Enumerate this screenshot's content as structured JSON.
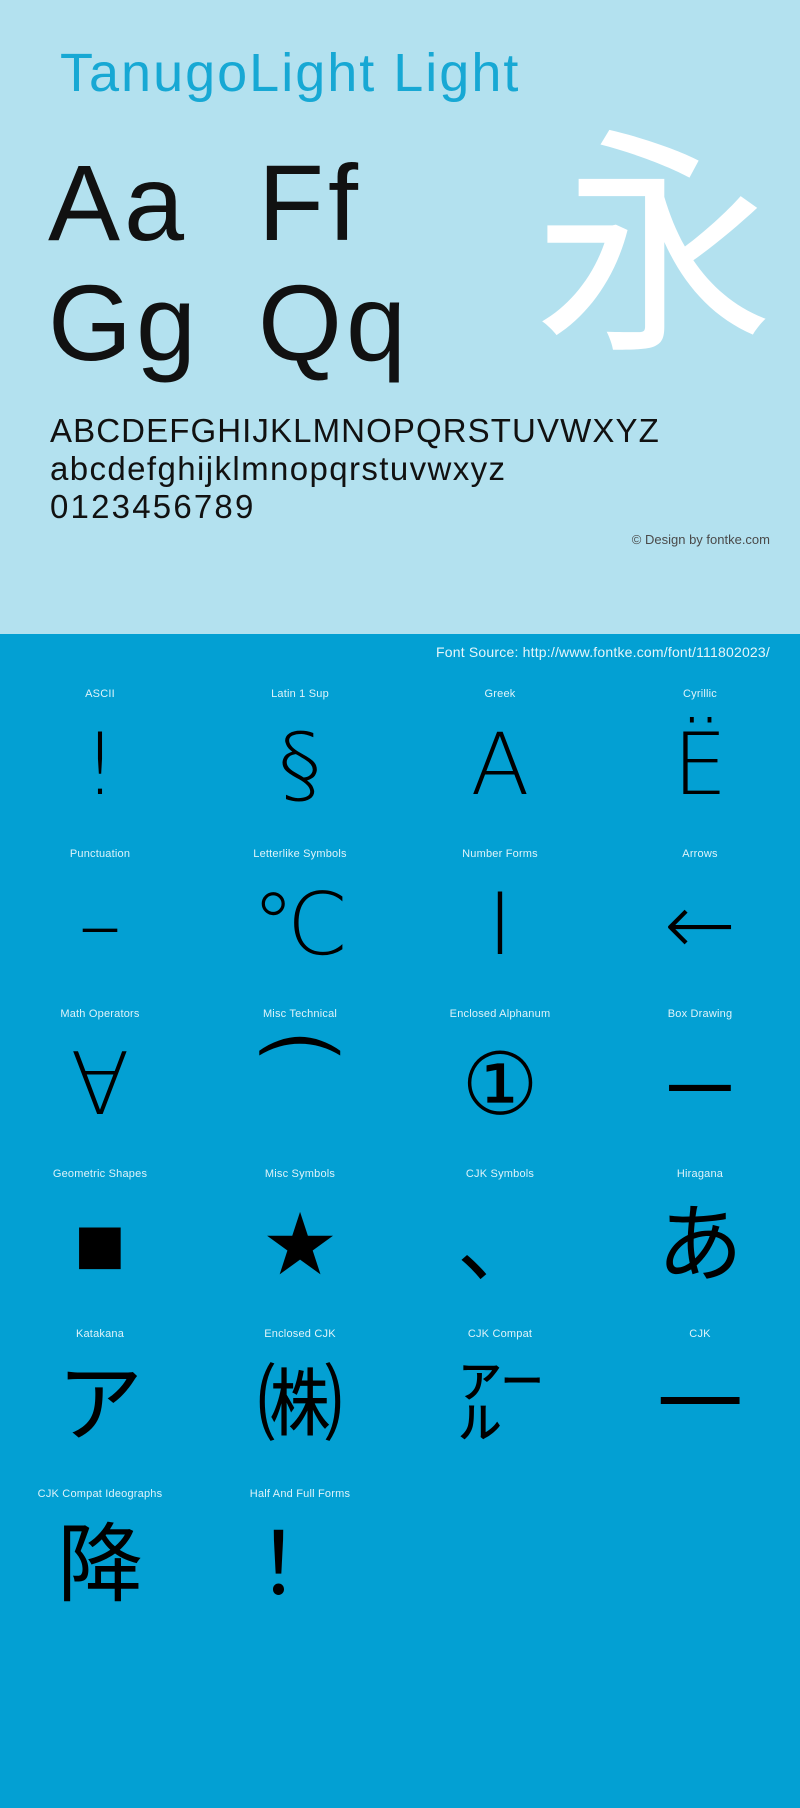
{
  "colors": {
    "top_background": "#b3e1ef",
    "bottom_background": "#03a0d3",
    "title": "#17a8d4",
    "glyph": "#000000",
    "watermark": "#ffffff",
    "label": "#dff3fa",
    "copyright": "#4a4a4a"
  },
  "header": {
    "title": "TanugoLight Light"
  },
  "specimen": {
    "rows": [
      {
        "left": "Aa",
        "right": "Ff"
      },
      {
        "left": "Gg",
        "right": "Qq"
      }
    ],
    "watermark_glyph": "永",
    "uppercase": "ABCDEFGHIJKLMNOPQRSTUVWXYZ",
    "lowercase": "abcdefghijklmnopqrstuvwxyz",
    "digits": "0123456789",
    "copyright": "© Design by fontke.com"
  },
  "source": {
    "text": "Font Source: http://www.fontke.com/font/111802023/"
  },
  "glyph_grid": {
    "cells": [
      {
        "label": "ASCII",
        "glyph": "!",
        "size": "normal"
      },
      {
        "label": "Latin 1 Sup",
        "glyph": "§",
        "size": "normal"
      },
      {
        "label": "Greek",
        "glyph": "Α",
        "size": "normal"
      },
      {
        "label": "Cyrillic",
        "glyph": "Ё",
        "size": "normal"
      },
      {
        "label": "Punctuation",
        "glyph": "–",
        "size": "normal"
      },
      {
        "label": "Letterlike Symbols",
        "glyph": "℃",
        "size": "normal"
      },
      {
        "label": "Number Forms",
        "glyph": "Ⅰ",
        "size": "normal"
      },
      {
        "label": "Arrows",
        "glyph": "←",
        "size": "normal"
      },
      {
        "label": "Math Operators",
        "glyph": "∀",
        "size": "normal"
      },
      {
        "label": "Misc Technical",
        "glyph": "⏜",
        "size": "normal"
      },
      {
        "label": "Enclosed Alphanum",
        "glyph": "①",
        "size": "normal"
      },
      {
        "label": "Box Drawing",
        "glyph": "─",
        "size": "normal"
      },
      {
        "label": "Geometric Shapes",
        "glyph": "■",
        "size": "normal"
      },
      {
        "label": "Misc Symbols",
        "glyph": "★",
        "size": "normal"
      },
      {
        "label": "CJK Symbols",
        "glyph": "、",
        "size": "normal"
      },
      {
        "label": "Hiragana",
        "glyph": "あ",
        "size": "normal"
      },
      {
        "label": "Katakana",
        "glyph": "ア",
        "size": "normal"
      },
      {
        "label": "Enclosed CJK",
        "glyph": "㈱",
        "size": "normal"
      },
      {
        "label": "CJK Compat",
        "glyph": "㌃",
        "size": "normal"
      },
      {
        "label": "CJK",
        "glyph": "一",
        "size": "normal"
      },
      {
        "label": "CJK Compat Ideographs",
        "glyph": "降",
        "size": "normal"
      },
      {
        "label": "Half And Full Forms",
        "glyph": "！",
        "size": "normal"
      },
      {
        "label": "",
        "glyph": "",
        "size": "normal"
      },
      {
        "label": "",
        "glyph": "",
        "size": "normal"
      }
    ]
  }
}
